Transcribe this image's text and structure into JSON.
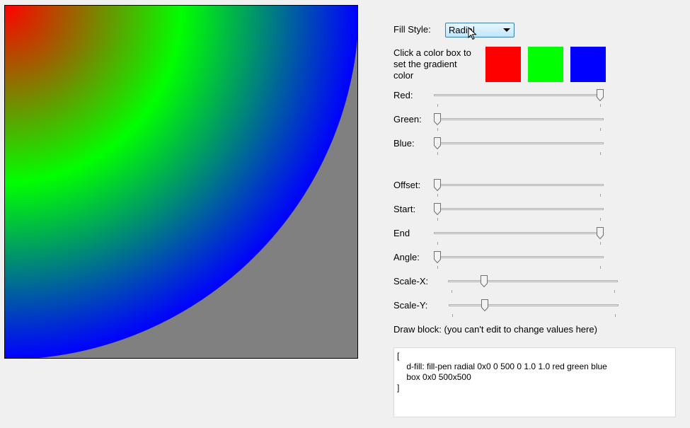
{
  "fill_style": {
    "label": "Fill Style:",
    "selected": "Radial"
  },
  "hint": "Click a color box to set the gradient color",
  "swatches": [
    {
      "name": "red",
      "color": "#ff0000"
    },
    {
      "name": "green",
      "color": "#00ff00"
    },
    {
      "name": "blue",
      "color": "#0000ff"
    }
  ],
  "sliders": {
    "red": {
      "label": "Red:",
      "value": 1.0
    },
    "green": {
      "label": "Green:",
      "value": 0.0
    },
    "blue": {
      "label": "Blue:",
      "value": 0.0
    },
    "offset": {
      "label": "Offset:",
      "value": 0.0
    },
    "start": {
      "label": "Start:",
      "value": 0.0
    },
    "end": {
      "label": "End",
      "value": 1.0
    },
    "angle": {
      "label": "Angle:",
      "value": 0.0
    },
    "scale_x": {
      "label": "Scale-X:",
      "value": 0.2
    },
    "scale_y": {
      "label": "Scale-Y:",
      "value": 0.2
    }
  },
  "draw_block": {
    "label": "Draw block: (you can't edit to change values here)",
    "text": "[\n    d-fill: fill-pen radial 0x0 0 500 0 1.0 1.0 red green blue\n    box 0x0 500x500\n]"
  }
}
